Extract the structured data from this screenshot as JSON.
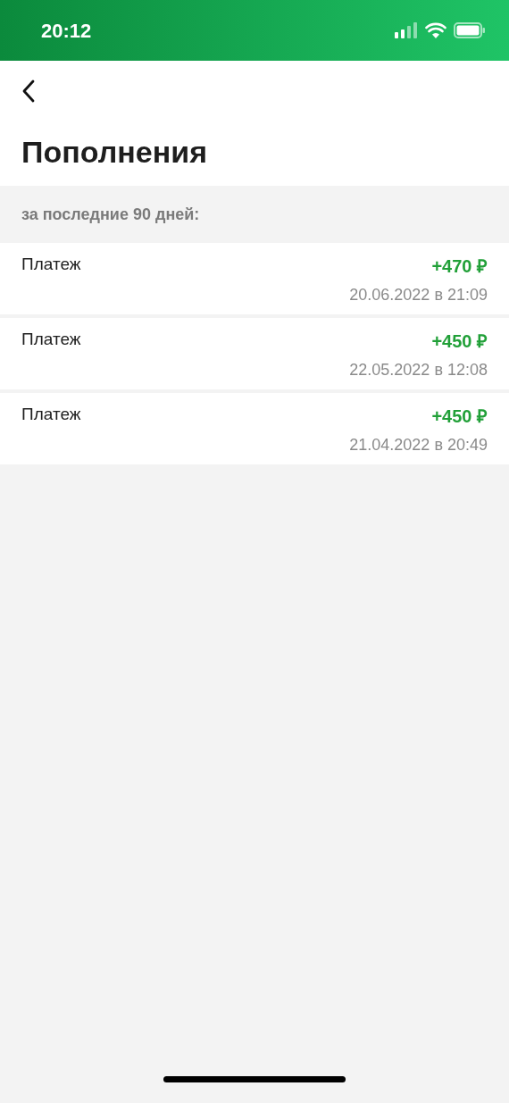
{
  "status_bar": {
    "time": "20:12"
  },
  "header": {
    "title": "Пополнения"
  },
  "section": {
    "label": "за последние 90 дней:"
  },
  "transactions": [
    {
      "name": "Платеж",
      "amount": "+470 ₽",
      "date": "20.06.2022 в 21:09"
    },
    {
      "name": "Платеж",
      "amount": "+450 ₽",
      "date": "22.05.2022 в 12:08"
    },
    {
      "name": "Платеж",
      "amount": "+450 ₽",
      "date": "21.04.2022 в 20:49"
    }
  ]
}
